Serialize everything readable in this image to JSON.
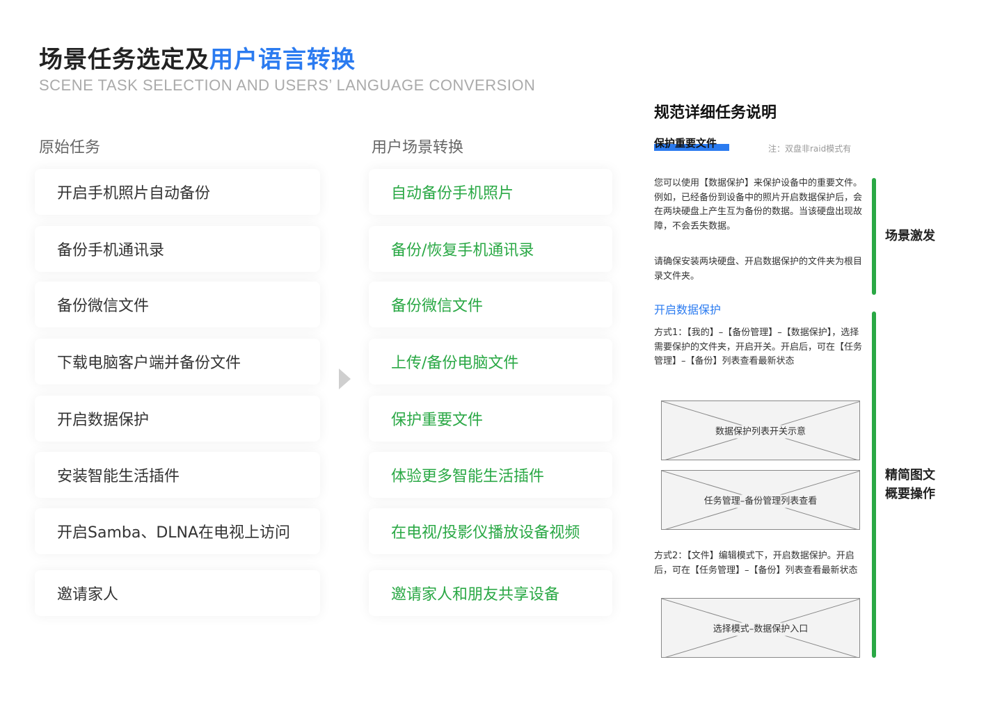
{
  "header": {
    "title_main": "场景任务选定及",
    "title_highlight": "用户语言转换",
    "subtitle": "SCENE TASK SELECTION AND USERS’ LANGUAGE CONVERSION"
  },
  "columns": {
    "original_header": "原始任务",
    "converted_header": "用户场景转换"
  },
  "original_tasks": [
    "开启手机照片自动备份",
    "备份手机通讯录",
    "备份微信文件",
    "下载电脑客户端并备份文件",
    "开启数据保护",
    "安装智能生活插件",
    "开启Samba、DLNA在电视上访问",
    "邀请家人"
  ],
  "converted_tasks": [
    "自动备份手机照片",
    "备份/恢复手机通讯录",
    "备份微信文件",
    "上传/备份电脑文件",
    "保护重要文件",
    "体验更多智能生活插件",
    "在电视/投影仪播放设备视频",
    "邀请家人和朋友共享设备"
  ],
  "detail": {
    "title": "规范详细任务说明",
    "tag": "保护重要文件",
    "note": "注：双盘非raid模式有",
    "para1": "您可以使用【数据保护】来保护设备中的重要文件。例如，已经备份到设备中的照片开启数据保护后，会在两块硬盘上产生互为备份的数据。当该硬盘出现故障，不会丢失数据。",
    "para2": "请确保安装两块硬盘、开启数据保护的文件夹为根目录文件夹。",
    "sub_title": "开启数据保护",
    "method1": "方式1：【我的】–【备份管理】–【数据保护】，选择需要保护的文件夹，开启开关。开启后，可在【任务管理】–【备份】列表查看最新状态",
    "wire1": "数据保护列表开关示意",
    "wire2": "任务管理–备份管理列表查看",
    "method2": "方式2：【文件】编辑模式下，开启数据保护。开启后，可在【任务管理】–【备份】列表查看最新状态",
    "wire3": "选择模式–数据保护入口"
  },
  "side_labels": {
    "scene_trigger": "场景激发",
    "overview_line1": "精简图文",
    "overview_line2": "概要操作"
  },
  "colors": {
    "accent_blue": "#2b7bf0",
    "accent_green": "#2aa845"
  }
}
